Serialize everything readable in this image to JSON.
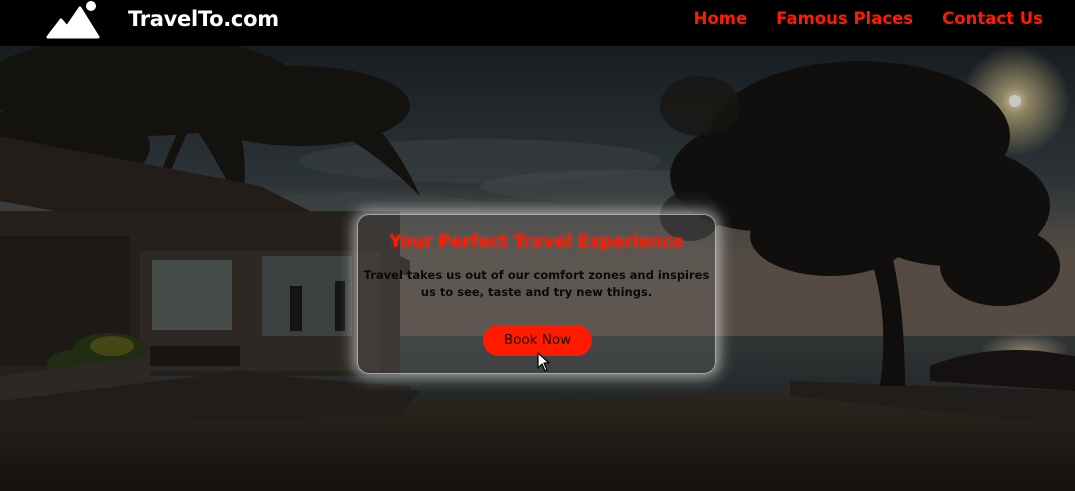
{
  "header": {
    "brand": "TravelTo.com",
    "logo_icon": "mountain-sun-icon",
    "nav": [
      {
        "label": "Home"
      },
      {
        "label": "Famous Places"
      },
      {
        "label": "Contact Us"
      }
    ]
  },
  "hero": {
    "background": "night-beach-scene-with-palm-trees-and-house",
    "card": {
      "title": "Your Perfect Travel Experience",
      "text": "Travel takes us out of our comfort zones and inspires us to see, taste and try new things.",
      "button_label": "Book Now"
    }
  },
  "colors": {
    "accent": "#ff1a00",
    "navbar_bg": "#000000",
    "brand_text": "#ffffff"
  }
}
